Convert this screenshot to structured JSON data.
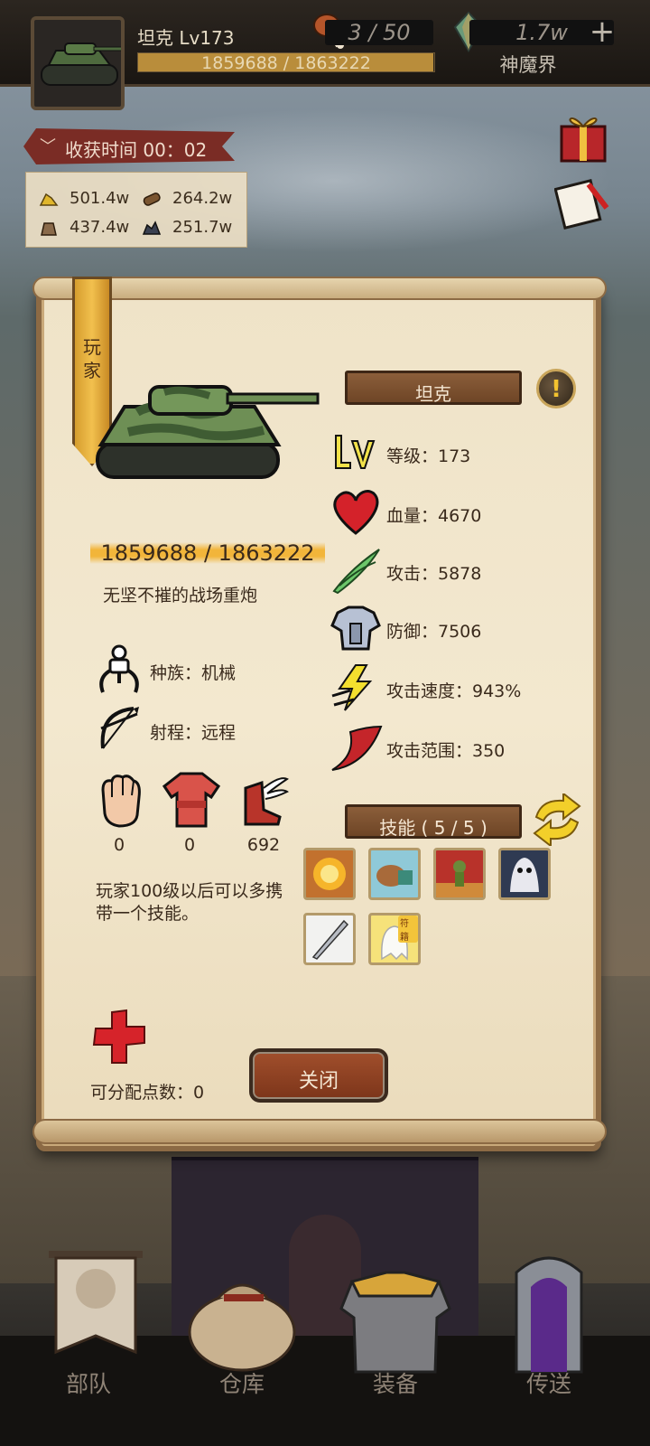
{
  "player": {
    "name_level": "坦克 Lv173",
    "exp_text": "1859688 / 1863222",
    "exp_fraction": 0.998
  },
  "top": {
    "stamina": "3 / 50",
    "currency": "1.7w",
    "currency_label": "神魔界",
    "plus": "+"
  },
  "harvest": {
    "label": "收获时间 00：02"
  },
  "resources": [
    {
      "icon": "gold-pile-icon",
      "value": "501.4w"
    },
    {
      "icon": "wood-log-icon",
      "value": "264.2w"
    },
    {
      "icon": "sack-icon",
      "value": "437.4w"
    },
    {
      "icon": "ore-icon",
      "value": "251.7w"
    }
  ],
  "dialog": {
    "banner_text": "玩\n家",
    "hp_text": "1859688 / 1863222",
    "description": "无坚不摧的战场重炮",
    "race": "种族：机械",
    "range": "射程：远程",
    "equipment_counts": [
      "0",
      "0",
      "692"
    ],
    "tip": "玩家100级以后可以多携带一个技能。",
    "points": "可分配点数：0",
    "close": "关闭",
    "unit_name": "坦克",
    "info_mark": "!",
    "stats": [
      {
        "icon": "level-icon",
        "label": "等级：173"
      },
      {
        "icon": "heart-icon",
        "label": "血量：4670"
      },
      {
        "icon": "attack-blades-icon",
        "label": "攻击：5878"
      },
      {
        "icon": "armor-icon",
        "label": "防御：7506"
      },
      {
        "icon": "lightning-icon",
        "label": "攻击速度：943%"
      },
      {
        "icon": "crescent-range-icon",
        "label": "攻击范围：350"
      }
    ],
    "skills_title": "技能 ( 5 / 5 )",
    "skill_slots": [
      "explosion-skill-icon",
      "beast-skill-icon",
      "goblin-skill-icon",
      "ghost-beast-skill-icon",
      "blade-skill-icon",
      "ghost-skill-icon"
    ],
    "skill_badge": "符籍"
  },
  "nav": [
    "部队",
    "仓库",
    "装备",
    "传送"
  ],
  "colors": {
    "parchment": "#f1e5ca",
    "plate": "#7c4f2e",
    "gold": "#f2b53a",
    "close_button": "#8f4123"
  }
}
